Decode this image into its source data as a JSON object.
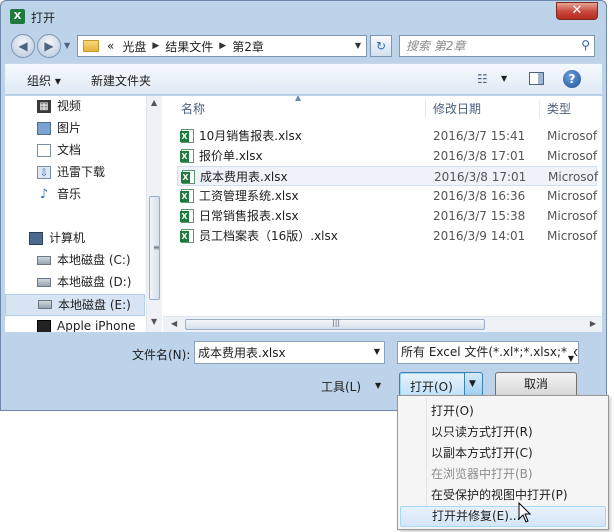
{
  "window": {
    "title": "打开",
    "app_icon_letter": "X",
    "close_glyph": "✕"
  },
  "nav": {
    "breadcrumb": [
      "«",
      "光盘",
      "结果文件",
      "第2章"
    ],
    "search_placeholder": "搜索 第2章"
  },
  "toolbar": {
    "organize": "组织 ▾",
    "new_folder": "新建文件夹"
  },
  "sidebar": {
    "items": [
      {
        "label": "视频",
        "icon": "video-icon"
      },
      {
        "label": "图片",
        "icon": "pictures-icon"
      },
      {
        "label": "文档",
        "icon": "documents-icon"
      },
      {
        "label": "迅雷下载",
        "icon": "download-icon"
      },
      {
        "label": "音乐",
        "icon": "music-icon"
      },
      {
        "label": "计算机",
        "icon": "computer-icon"
      },
      {
        "label": "本地磁盘 (C:)",
        "icon": "drive-icon"
      },
      {
        "label": "本地磁盘 (D:)",
        "icon": "drive-icon"
      },
      {
        "label": "本地磁盘 (E:)",
        "icon": "drive-icon",
        "selected": true
      },
      {
        "label": "Apple iPhone",
        "icon": "phone-icon"
      }
    ]
  },
  "columns": {
    "name": "名称",
    "date": "修改日期",
    "type": "类型"
  },
  "files": [
    {
      "name": "10月销售报表.xlsx",
      "date": "2016/3/7 15:41",
      "type": "Microsof"
    },
    {
      "name": "报价单.xlsx",
      "date": "2016/3/8 17:01",
      "type": "Microsof"
    },
    {
      "name": "成本费用表.xlsx",
      "date": "2016/3/8 17:01",
      "type": "Microsof",
      "selected": true
    },
    {
      "name": "工资管理系统.xlsx",
      "date": "2016/3/8 16:36",
      "type": "Microsof"
    },
    {
      "name": "日常销售报表.xlsx",
      "date": "2016/3/7 15:38",
      "type": "Microsof"
    },
    {
      "name": "员工档案表（16版）.xlsx",
      "date": "2016/3/9 14:01",
      "type": "Microsof"
    }
  ],
  "footer": {
    "filename_label": "文件名(N):",
    "filename_value": "成本费用表.xlsx",
    "filter_value": "所有 Excel 文件(*.xl*;*.xlsx;*.xl",
    "tools_label": "工具(L)",
    "open_label": "打开(O)",
    "cancel_label": "取消"
  },
  "open_menu": [
    {
      "label": "打开(O)",
      "enabled": true
    },
    {
      "label": "以只读方式打开(R)",
      "enabled": true
    },
    {
      "label": "以副本方式打开(C)",
      "enabled": true
    },
    {
      "label": "在浏览器中打开(B)",
      "enabled": false
    },
    {
      "label": "在受保护的视图中打开(P)",
      "enabled": true
    },
    {
      "label": "打开并修复(E)...",
      "enabled": true,
      "hovered": true
    }
  ]
}
